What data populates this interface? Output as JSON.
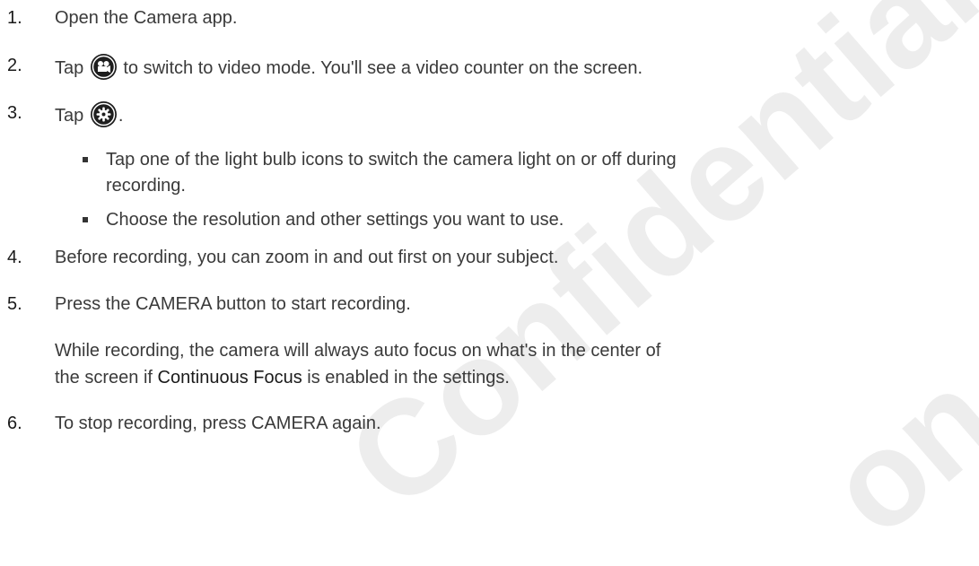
{
  "steps": [
    {
      "num": "1.",
      "text": "Open the Camera app."
    },
    {
      "num": "2.",
      "before": "Tap",
      "icon": "video-camera-icon",
      "after": "to switch to video mode. You'll see a video counter on the screen."
    },
    {
      "num": "3.",
      "before": "Tap",
      "icon": "settings-gear-icon",
      "after": "."
    },
    {
      "num": "4.",
      "text": "Before recording, you can zoom in and out first on your subject."
    },
    {
      "num": "5.",
      "text": "Press the CAMERA button to start recording."
    },
    {
      "num": "6.",
      "text": "To stop recording, press CAMERA again."
    }
  ],
  "bullets": [
    {
      "line1": "Tap one of the light bulb icons to switch the camera light on or off during",
      "line2": "recording."
    },
    {
      "text": "Choose the resolution and other settings you want to use."
    }
  ],
  "note": {
    "line1": "While recording, the camera will always auto focus on what's in the center of",
    "line2_before": "the screen if ",
    "line2_bold": "Continuous Focus",
    "line2_after": " is enabled in the settings."
  },
  "watermark": {
    "word1": "Confidential",
    "word2": "on"
  }
}
